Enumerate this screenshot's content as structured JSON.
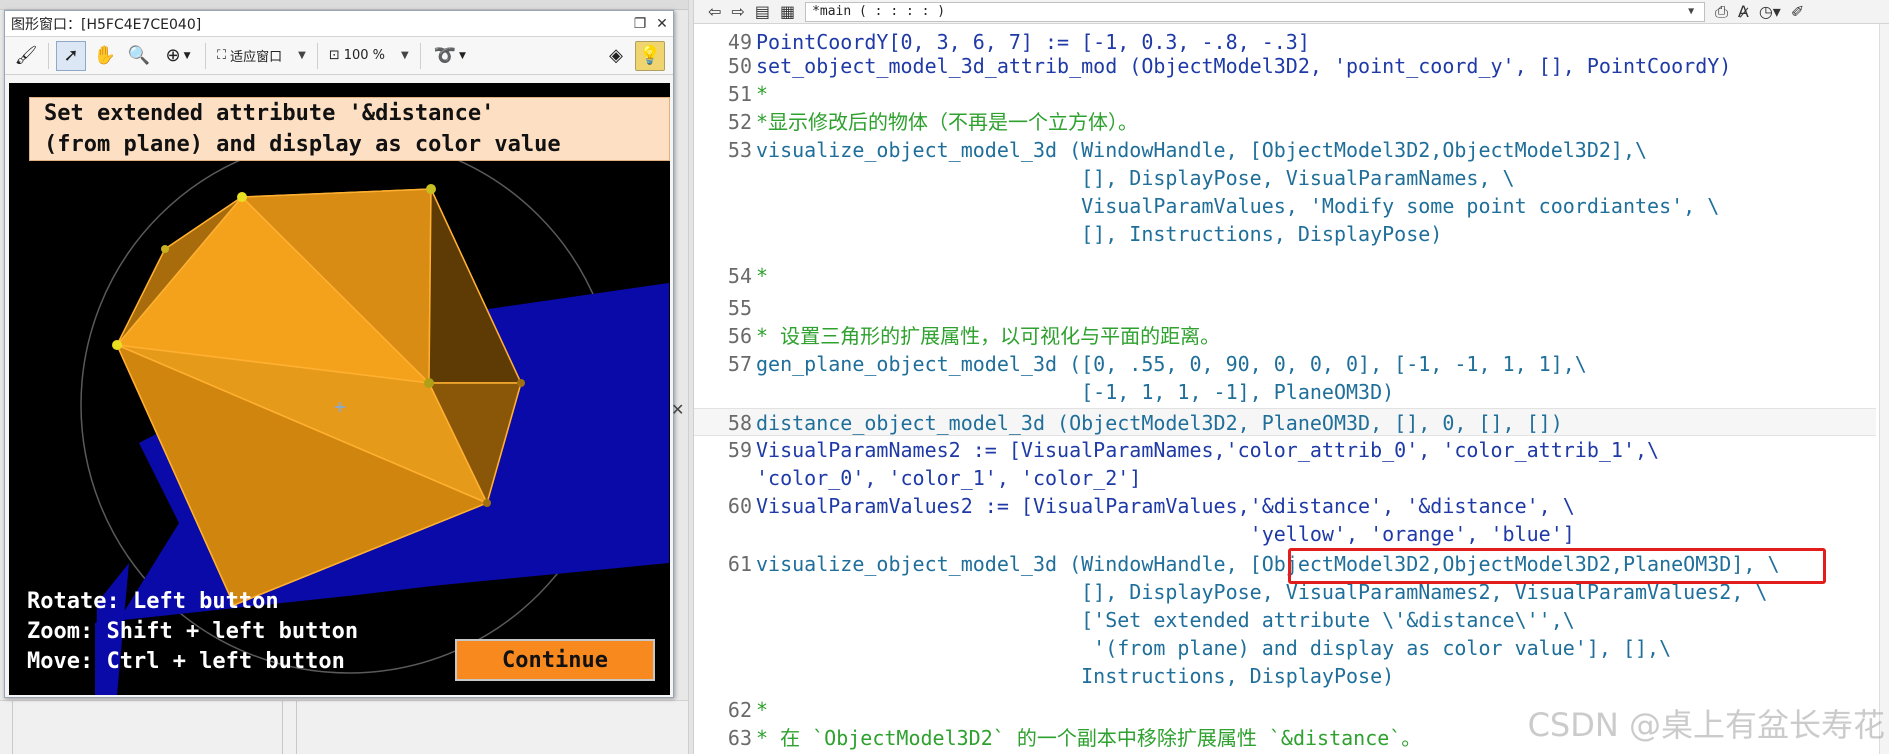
{
  "graphics_window": {
    "title": "图形窗口：[H5FC4E7CE040]",
    "toolbar": {
      "fit_window_label": "适应窗口",
      "zoom_label": "100 %"
    },
    "banner_line1": "Set extended attribute '&distance'",
    "banner_line2": "(from plane) and display as color value",
    "help": {
      "rotate": "Rotate: Left button",
      "zoom": "Zoom: Shift + left button",
      "move": "Move: Ctrl + left button"
    },
    "continue_label": "Continue"
  },
  "editor": {
    "context": "*main ( : : : : )",
    "lines": {
      "l49": {
        "num": "49",
        "text": "PointCoordY[0, 3, 6, 7] := [-1, 0.3, -.8, -.3]"
      },
      "l50": {
        "num": "50",
        "text": "set_object_model_3d_attrib_mod (ObjectModel3D2, 'point_coord_y', [], PointCoordY)"
      },
      "l51": {
        "num": "51",
        "text": "*"
      },
      "l52": {
        "num": "52",
        "text": "*显示修改后的物体（不再是一个立方体）。"
      },
      "l53": {
        "num": "53",
        "text": "visualize_object_model_3d (WindowHandle, [ObjectModel3D2,ObjectModel3D2],\\"
      },
      "l53b": {
        "num": "",
        "text": "                           [], DisplayPose, VisualParamNames, \\"
      },
      "l53c": {
        "num": "",
        "text": "                           VisualParamValues, 'Modify some point coordiantes', \\"
      },
      "l53d": {
        "num": "",
        "text": "                           [], Instructions, DisplayPose)"
      },
      "l54": {
        "num": "54",
        "text": "*"
      },
      "l55": {
        "num": "55",
        "text": ""
      },
      "l56": {
        "num": "56",
        "text": "* 设置三角形的扩展属性，以可视化与平面的距离。"
      },
      "l57": {
        "num": "57",
        "text": "gen_plane_object_model_3d ([0, .55, 0, 90, 0, 0, 0], [-1, -1, 1, 1],\\"
      },
      "l57b": {
        "num": "",
        "text": "                           [-1, 1, 1, -1], PlaneOM3D)"
      },
      "l58": {
        "num": "58",
        "text": "distance_object_model_3d (ObjectModel3D2, PlaneOM3D, [], 0, [], [])"
      },
      "l59": {
        "num": "59",
        "text": "VisualParamNames2 := [VisualParamNames,'color_attrib_0', 'color_attrib_1',\\"
      },
      "l59b": {
        "num": "",
        "text": "'color_0', 'color_1', 'color_2']"
      },
      "l60": {
        "num": "60",
        "text": "VisualParamValues2 := [VisualParamValues,'&distance', '&distance', \\"
      },
      "l60b": {
        "num": "",
        "text": "                                         'yellow', 'orange', 'blue']"
      },
      "l61": {
        "num": "61",
        "text": "visualize_object_model_3d (WindowHandle, [ObjectModel3D2,ObjectModel3D2,PlaneOM3D], \\"
      },
      "l61b": {
        "num": "",
        "text": "                           [], DisplayPose, VisualParamNames2, VisualParamValues2, \\"
      },
      "l61c": {
        "num": "",
        "text": "                           ['Set extended attribute \\'&distance\\'',\\"
      },
      "l61d": {
        "num": "",
        "text": "                            '(from plane) and display as color value'], [],\\"
      },
      "l61e": {
        "num": "",
        "text": "                           Instructions, DisplayPose)"
      },
      "l62": {
        "num": "62",
        "text": "*"
      },
      "l63": {
        "num": "63",
        "text": "* 在 `ObjectModel3D2` 的一个副本中移除扩展属性 `&distance`。"
      }
    }
  },
  "watermark": "CSDN @桌上有盆长寿花",
  "colors": {
    "accent_red": "#e31c1c",
    "continue_orange": "#f7891f",
    "plane_blue": "#0a0aa8",
    "object_orange": "#f0a21e"
  }
}
